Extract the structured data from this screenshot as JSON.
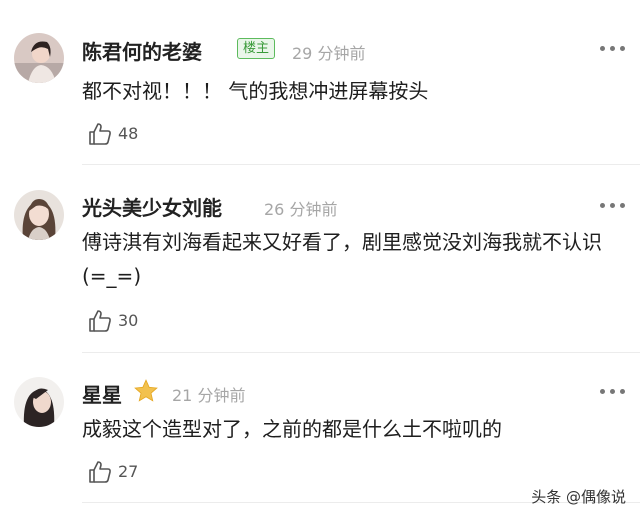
{
  "comments": [
    {
      "user": "陈君何的老婆",
      "badge": "楼主",
      "time": "29 分钟前",
      "text": "都不对视！！！ 气的我想冲进屏幕按头",
      "likes": "48"
    },
    {
      "user": "光头美少女刘能",
      "time": "26 分钟前",
      "text": "傅诗淇有刘海看起来又好看了，剧里感觉没刘海我就不认识 (=_=)",
      "likes": "30"
    },
    {
      "user": "星星",
      "time": "21 分钟前",
      "text": "成毅这个造型对了，之前的都是什么土不啦叽的",
      "likes": "27"
    }
  ],
  "watermark": "头条 @偶像说",
  "icons": {
    "more": "more-dots-icon",
    "like": "thumbs-up-icon",
    "star": "star-icon"
  },
  "colors": {
    "badge_green": "#3a9b3a",
    "time_gray": "#a6a6a6",
    "star_gold": "#f2c14e"
  }
}
